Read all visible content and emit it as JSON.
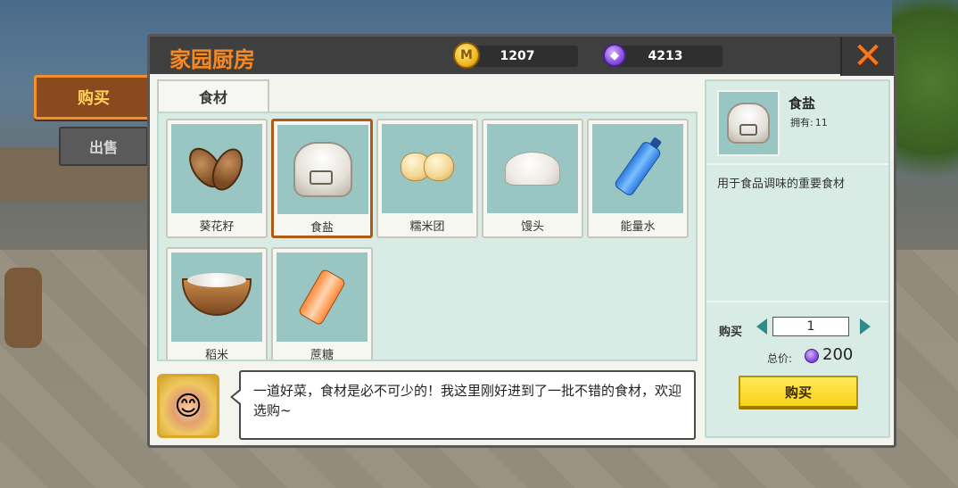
{
  "window": {
    "title": "家园厨房"
  },
  "currency": {
    "coins": "1207",
    "gems": "4213"
  },
  "icons": {
    "coin": "coin-icon",
    "gem": "gem-icon",
    "close": "close-icon",
    "coin_glyph": "M"
  },
  "side_tabs": {
    "buy": "购买",
    "sell": "出售"
  },
  "category": {
    "label": "食材"
  },
  "items": [
    {
      "label": "葵花籽",
      "icon": "sunflower-seed-icon"
    },
    {
      "label": "食盐",
      "icon": "salt-bag-icon",
      "selected": true
    },
    {
      "label": "糯米团",
      "icon": "mochi-icon"
    },
    {
      "label": "馒头",
      "icon": "steamed-bun-icon"
    },
    {
      "label": "能量水",
      "icon": "water-bottle-icon"
    },
    {
      "label": "稻米",
      "icon": "rice-bowl-icon"
    },
    {
      "label": "蔗糖",
      "icon": "sugar-bottle-icon"
    }
  ],
  "dialog": {
    "text": "一道好菜，食材是必不可少的！我这里刚好进到了一批不错的食材，欢迎选购~"
  },
  "detail": {
    "name": "食盐",
    "owned_label": "拥有:",
    "owned_value": "11",
    "description": "用于食品调味的重要食材",
    "buy_label": "购买",
    "quantity": "1",
    "total_label": "总价:",
    "total_value": "200",
    "buy_button": "购买"
  },
  "colors": {
    "accent_orange": "#f28a2a",
    "buy_yellow": "#f7d21a",
    "panel_teal": "#99c6c3"
  }
}
